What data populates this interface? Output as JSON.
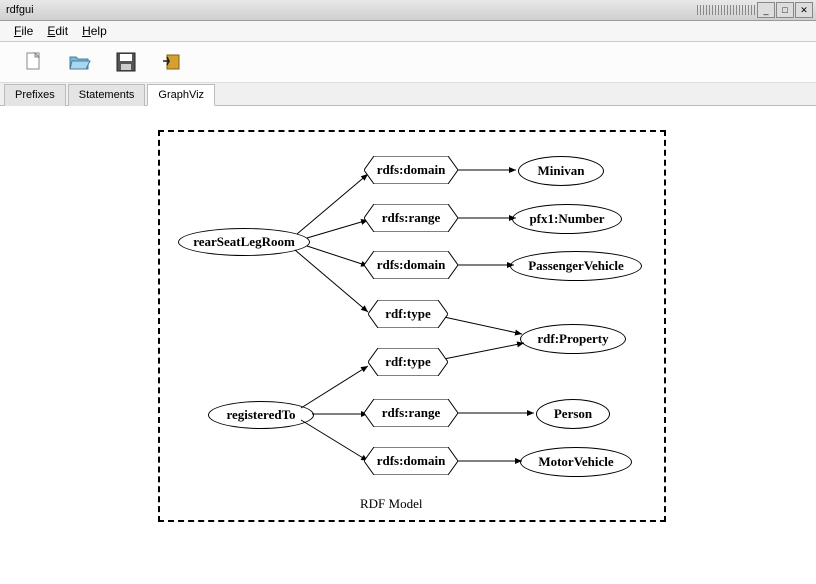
{
  "window": {
    "title": "rdfgui"
  },
  "menu": {
    "file": "File",
    "edit": "Edit",
    "help": "Help"
  },
  "tabs": {
    "prefixes": "Prefixes",
    "statements": "Statements",
    "graphviz": "GraphViz",
    "active": "graphviz"
  },
  "graph": {
    "label": "RDF Model",
    "subjects": {
      "rearSeatLegRoom": "rearSeatLegRoom",
      "registeredTo": "registeredTo"
    },
    "predicates": {
      "rdfs_domain": "rdfs:domain",
      "rdfs_range": "rdfs:range",
      "rdf_type": "rdf:type"
    },
    "objects": {
      "minivan": "Minivan",
      "pfx1_number": "pfx1:Number",
      "passenger_vehicle": "PassengerVehicle",
      "rdf_property": "rdf:Property",
      "person": "Person",
      "motor_vehicle": "MotorVehicle"
    },
    "edges": [
      {
        "from": "rearSeatLegRoom",
        "pred": "rdfs:domain",
        "to": "Minivan"
      },
      {
        "from": "rearSeatLegRoom",
        "pred": "rdfs:range",
        "to": "pfx1:Number"
      },
      {
        "from": "rearSeatLegRoom",
        "pred": "rdfs:domain",
        "to": "PassengerVehicle"
      },
      {
        "from": "rearSeatLegRoom",
        "pred": "rdf:type",
        "to": "rdf:Property"
      },
      {
        "from": "registeredTo",
        "pred": "rdf:type",
        "to": "rdf:Property"
      },
      {
        "from": "registeredTo",
        "pred": "rdfs:range",
        "to": "Person"
      },
      {
        "from": "registeredTo",
        "pred": "rdfs:domain",
        "to": "MotorVehicle"
      }
    ]
  }
}
